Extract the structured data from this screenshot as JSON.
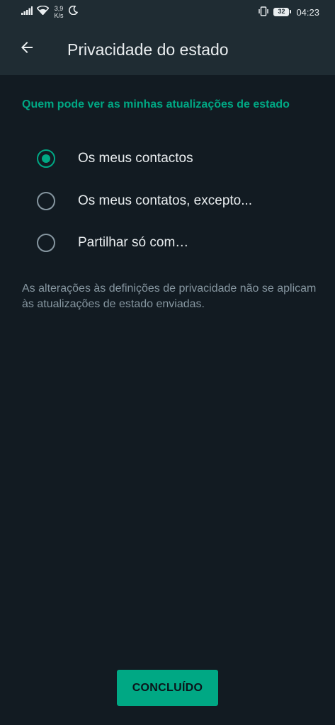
{
  "status_bar": {
    "speed_value": "3,9",
    "speed_unit": "K/s",
    "battery": "32",
    "time": "04:23",
    "icons": [
      "signal-icon",
      "wifi-icon",
      "moon-icon",
      "vibrate-icon",
      "battery-icon"
    ]
  },
  "toolbar": {
    "title": "Privacidade do estado",
    "back_icon": "arrow-left-icon"
  },
  "section_header": "Quem pode ver as minhas atualizações de estado",
  "options": [
    {
      "label": "Os meus contactos",
      "checked": true
    },
    {
      "label": "Os meus contatos, excepto...",
      "checked": false
    },
    {
      "label": "Partilhar só com…",
      "checked": false
    }
  ],
  "note": "As alterações às definições de privacidade não se aplicam às atualizações de estado enviadas.",
  "done_button": "CONCLUÍDO",
  "colors": {
    "background": "#121b22",
    "header": "#1f2c33",
    "accent": "#00a884",
    "primary_text": "#e9edef",
    "secondary_text": "#8696a0"
  }
}
